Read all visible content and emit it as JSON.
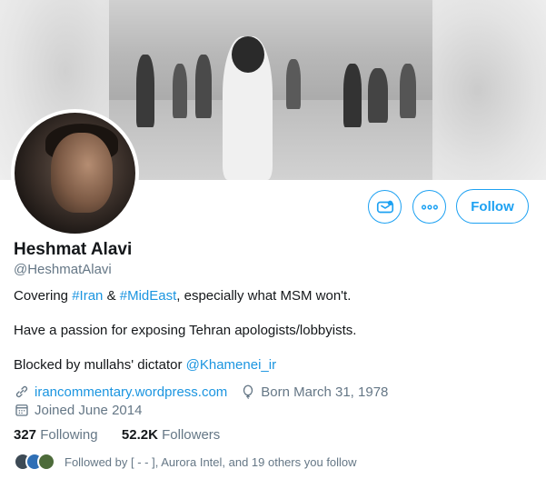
{
  "profile": {
    "name": "Heshmat Alavi",
    "handle": "@HeshmatAlavi",
    "follow_label": "Follow",
    "bio": {
      "line1_prefix": "Covering ",
      "tag1": "#Iran",
      "line1_mid": " & ",
      "tag2": "#MidEast",
      "line1_suffix": ", especially what MSM won't.",
      "line2": "Have a passion for exposing Tehran apologists/lobbyists.",
      "line3_prefix": "Blocked by mullahs' dictator ",
      "mention": "@Khamenei_ir"
    },
    "website": "irancommentary.wordpress.com",
    "born": "Born March 31, 1978",
    "joined": "Joined June 2014",
    "following_count": "327",
    "following_label": "Following",
    "followers_count": "52.2K",
    "followers_label": "Followers",
    "followed_by": "Followed by [ - - ], Aurora Intel, and 19 others you follow"
  },
  "icons": [
    "link-icon",
    "balloon-icon",
    "calendar-icon",
    "more-icon",
    "notifications-icon"
  ],
  "colors": {
    "accent": "#1da1f2",
    "link": "#1b95e0",
    "muted": "#657786",
    "text": "#14171a"
  }
}
